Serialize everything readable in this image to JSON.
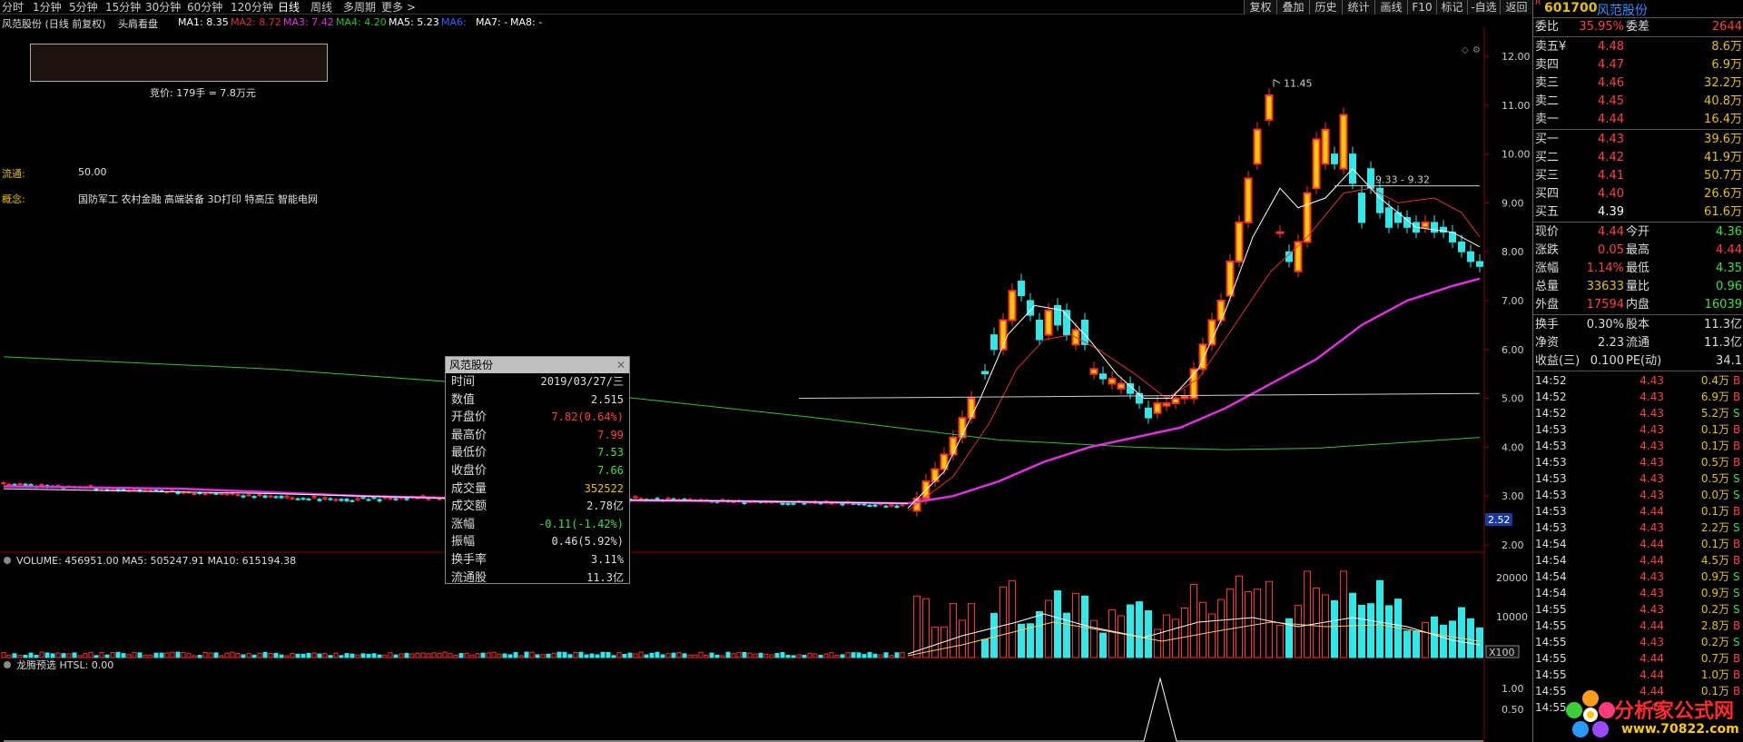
{
  "topbar": {
    "items": [
      "分时",
      "1分钟",
      "5分钟",
      "15分钟",
      "30分钟",
      "60分钟",
      "120分钟",
      "日线",
      "周线",
      "多周期",
      "更多 >"
    ],
    "active": "日线",
    "right_buttons": [
      "复权",
      "叠加",
      "历史",
      "统计",
      "画线",
      "F10",
      "标记",
      "-自选",
      "返回"
    ]
  },
  "ma_legend": {
    "title": "风范股份 (日线 前复权)",
    "indicator": "头肩看盘",
    "items": [
      {
        "t": "MA1: 8.35",
        "c": "#ffffff"
      },
      {
        "t": "MA2: 8.72",
        "c": "#e03030"
      },
      {
        "t": "MA3: 7.42",
        "c": "#e030e0"
      },
      {
        "t": "MA4: 4.20",
        "c": "#30c030"
      },
      {
        "t": "MA5: 5.23",
        "c": "#ffffff"
      },
      {
        "t": "MA6:",
        "c": "#3060ff"
      },
      {
        "t": "MA7: -",
        "c": "#ffffff"
      },
      {
        "t": "MA8: -",
        "c": "#ffffff"
      }
    ]
  },
  "info_panel": {
    "bid_text": "竞价: 179手 = 7.8万元",
    "float_label": "流通:",
    "float_value": "50.00",
    "concept_label": "概念:",
    "concept_value": "国防军工 农村金融 高端装备 3D打印 特高压 智能电网"
  },
  "price_axis": {
    "ticks": [
      "12.00",
      "11.00",
      "10.00",
      "9.00",
      "8.00",
      "7.00",
      "6.00",
      "5.00",
      "4.00",
      "3.00",
      "2.00"
    ],
    "current_marker": "2.52",
    "high_label": "11.45",
    "range_label": "9.33 - 9.32"
  },
  "volume_panel": {
    "label": "VOLUME: 456951.00  MA5: 505247.91  MA10: 615194.38",
    "ticks": [
      "20000",
      "10000"
    ],
    "unit": "X100"
  },
  "indicator_panel": {
    "label": "龙腾预选  HTSL: 0.00",
    "ticks": [
      "1.00",
      "0.50"
    ]
  },
  "tooltip": {
    "title": "风范股份",
    "rows": [
      {
        "k": "时间",
        "v": "2019/03/27/三",
        "c": "#dddddd"
      },
      {
        "k": "数值",
        "v": "2.515",
        "c": "#dddddd"
      },
      {
        "k": "开盘价",
        "v": "7.82(0.64%)",
        "c": "#ff4040"
      },
      {
        "k": "最高价",
        "v": "7.99",
        "c": "#ff4040"
      },
      {
        "k": "最低价",
        "v": "7.53",
        "c": "#40e040"
      },
      {
        "k": "收盘价",
        "v": "7.66",
        "c": "#40e040"
      },
      {
        "k": "成交量",
        "v": "352522",
        "c": "#e6c200"
      },
      {
        "k": "成交额",
        "v": "2.78亿",
        "c": "#dddddd"
      },
      {
        "k": "涨幅",
        "v": "-0.11(-1.42%)",
        "c": "#40e040"
      },
      {
        "k": "振幅",
        "v": "0.46(5.92%)",
        "c": "#dddddd"
      },
      {
        "k": "换手率",
        "v": "3.11%",
        "c": "#dddddd"
      },
      {
        "k": "流通股",
        "v": "11.3亿",
        "c": "#dddddd"
      }
    ]
  },
  "quote": {
    "code": "601700",
    "name": "风范股份",
    "code_prefix": "R",
    "weibi": {
      "k": "委比",
      "v": "35.95%",
      "k2": "委差",
      "v2": "2644"
    },
    "sells": [
      {
        "k": "卖五",
        "p": "4.48",
        "v": "8.6万"
      },
      {
        "k": "卖四",
        "p": "4.47",
        "v": "6.9万"
      },
      {
        "k": "卖三",
        "p": "4.46",
        "v": "32.2万"
      },
      {
        "k": "卖二",
        "p": "4.45",
        "v": "40.8万"
      },
      {
        "k": "卖一",
        "p": "4.44",
        "v": "16.4万"
      }
    ],
    "sell5_suffix": "¥",
    "buys": [
      {
        "k": "买一",
        "p": "4.43",
        "v": "39.6万"
      },
      {
        "k": "买二",
        "p": "4.42",
        "v": "41.9万"
      },
      {
        "k": "买三",
        "p": "4.41",
        "v": "50.7万"
      },
      {
        "k": "买四",
        "p": "4.40",
        "v": "26.6万"
      },
      {
        "k": "买五",
        "p": "4.39",
        "v": "61.6万"
      }
    ],
    "stats": [
      {
        "k": "现价",
        "v": "4.44",
        "c": "#ff4040",
        "k2": "今开",
        "v2": "4.36",
        "c2": "#40e040"
      },
      {
        "k": "涨跌",
        "v": "0.05",
        "c": "#ff4040",
        "k2": "最高",
        "v2": "4.44",
        "c2": "#ff4040"
      },
      {
        "k": "涨幅",
        "v": "1.14%",
        "c": "#ff4040",
        "k2": "最低",
        "v2": "4.35",
        "c2": "#40e040"
      },
      {
        "k": "总量",
        "v": "33633",
        "c": "#e6c200",
        "k2": "量比",
        "v2": "0.96",
        "c2": "#40e040"
      },
      {
        "k": "外盘",
        "v": "17594",
        "c": "#ff4040",
        "k2": "内盘",
        "v2": "16039",
        "c2": "#40e040"
      }
    ],
    "stats2": [
      {
        "k": "换手",
        "v": "0.30%",
        "c": "#dddddd",
        "k2": "股本",
        "v2": "11.3亿",
        "c2": "#dddddd"
      },
      {
        "k": "净资",
        "v": "2.23",
        "c": "#dddddd",
        "k2": "流通",
        "v2": "11.3亿",
        "c2": "#dddddd"
      },
      {
        "k": "收益(三)",
        "v": "0.100",
        "c": "#dddddd",
        "k2": "PE(动)",
        "v2": "34.1",
        "c2": "#dddddd"
      }
    ],
    "ticks": [
      {
        "t": "14:52",
        "p": "4.43",
        "v": "0.4万",
        "d": "B"
      },
      {
        "t": "14:52",
        "p": "4.43",
        "v": "6.9万",
        "d": "B"
      },
      {
        "t": "14:52",
        "p": "4.43",
        "v": "5.2万",
        "d": "S"
      },
      {
        "t": "14:53",
        "p": "4.43",
        "v": "0.1万",
        "d": "B"
      },
      {
        "t": "14:53",
        "p": "4.43",
        "v": "0.1万",
        "d": "B"
      },
      {
        "t": "14:53",
        "p": "4.43",
        "v": "0.5万",
        "d": "B"
      },
      {
        "t": "14:53",
        "p": "4.43",
        "v": "0.5万",
        "d": "S"
      },
      {
        "t": "14:53",
        "p": "4.43",
        "v": "0.0万",
        "d": "S"
      },
      {
        "t": "14:53",
        "p": "4.44",
        "v": "0.1万",
        "d": "B"
      },
      {
        "t": "14:53",
        "p": "4.43",
        "v": "2.2万",
        "d": "S"
      },
      {
        "t": "14:54",
        "p": "4.44",
        "v": "0.1万",
        "d": "B"
      },
      {
        "t": "14:54",
        "p": "4.44",
        "v": "4.5万",
        "d": "B"
      },
      {
        "t": "14:54",
        "p": "4.43",
        "v": "0.9万",
        "d": "S"
      },
      {
        "t": "14:54",
        "p": "4.43",
        "v": "0.9万",
        "d": "S"
      },
      {
        "t": "14:55",
        "p": "4.43",
        "v": "0.2万",
        "d": "S"
      },
      {
        "t": "14:55",
        "p": "4.44",
        "v": "2.8万",
        "d": "B"
      },
      {
        "t": "14:55",
        "p": "4.43",
        "v": "0.2万",
        "d": "S"
      },
      {
        "t": "14:55",
        "p": "4.44",
        "v": "0.7万",
        "d": "B"
      },
      {
        "t": "14:55",
        "p": "4.44",
        "v": "1.0万",
        "d": "B"
      },
      {
        "t": "14:55",
        "p": "4.44",
        "v": "0.1万",
        "d": "B"
      },
      {
        "t": "14:55",
        "p": "4.44",
        "v": "",
        "d": ""
      }
    ]
  },
  "watermark": {
    "text1": "分析家公式网",
    "text2": "www.70822.com"
  },
  "colors": {
    "up": "#ff3030",
    "down": "#30e8e8",
    "ma_white": "#ffffff",
    "ma_red": "#e03030",
    "ma_magenta": "#e030e0",
    "ma_green": "#30c030"
  }
}
